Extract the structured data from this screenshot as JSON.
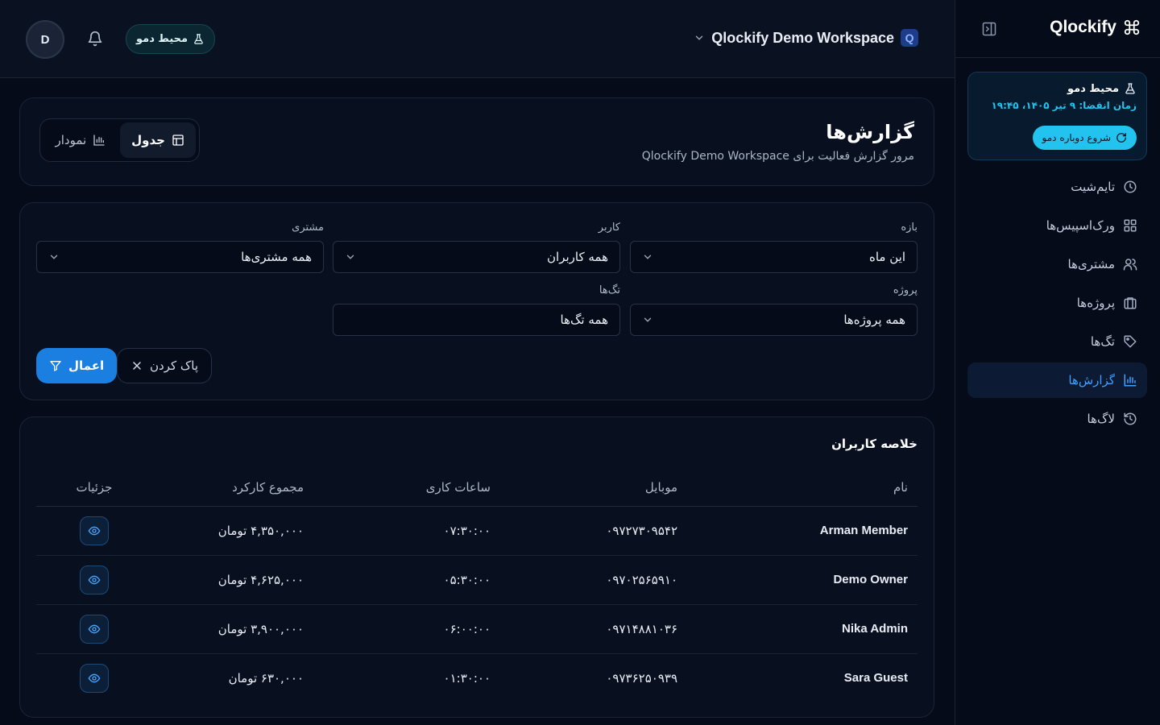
{
  "sidebar": {
    "brand": "Qlockify",
    "demo": {
      "title": "محیط دمو",
      "expires": "زمان انقضا: ۹ تیر ۱۴۰۵، ۱۹:۴۵",
      "restart_label": "شروع دوباره دمو"
    },
    "items": [
      {
        "label": "تایم‌شیت",
        "icon": "clock-icon"
      },
      {
        "label": "ورک‌اسپیس‌ها",
        "icon": "grid-icon"
      },
      {
        "label": "مشتری‌ها",
        "icon": "users-icon"
      },
      {
        "label": "پروژه‌ها",
        "icon": "briefcase-icon"
      },
      {
        "label": "تگ‌ها",
        "icon": "tag-icon"
      },
      {
        "label": "گزارش‌ها",
        "icon": "bar-chart-icon",
        "active": true
      },
      {
        "label": "لاگ‌ها",
        "icon": "history-icon"
      }
    ]
  },
  "topbar": {
    "workspace_name": "Qlockify Demo Workspace",
    "workspace_badge": "Q",
    "env_label": "محیط دمو",
    "avatar_initial": "D"
  },
  "header": {
    "title": "گزارش‌ها",
    "subtitle": "مرور گزارش فعالیت برای Qlockify Demo Workspace",
    "view_table": "جدول",
    "view_chart": "نمودار"
  },
  "filters": {
    "range": {
      "label": "بازه",
      "value": "این ماه"
    },
    "user": {
      "label": "کاربر",
      "value": "همه کاربران"
    },
    "client": {
      "label": "مشتری",
      "value": "همه مشتری‌ها"
    },
    "project": {
      "label": "پروژه",
      "value": "همه پروژه‌ها"
    },
    "tags": {
      "label": "تگ‌ها",
      "value": "همه تگ‌ها"
    },
    "apply_label": "اعمال",
    "clear_label": "پاک کردن"
  },
  "summary": {
    "title": "خلاصه کاربران",
    "columns": {
      "name": "نام",
      "mobile": "موبایل",
      "hours": "ساعات کاری",
      "total": "مجموع کارکرد",
      "details": "جزئیات"
    },
    "rows": [
      {
        "name": "Arman Member",
        "mobile": "۰۹۷۲۷۳۰۹۵۴۲",
        "hours": "۰۷:۳۰:۰۰",
        "total": "۴,۳۵۰,۰۰۰ تومان"
      },
      {
        "name": "Demo Owner",
        "mobile": "۰۹۷۰۲۵۶۵۹۱۰",
        "hours": "۰۵:۳۰:۰۰",
        "total": "۴,۶۲۵,۰۰۰ تومان"
      },
      {
        "name": "Nika Admin",
        "mobile": "۰۹۷۱۴۸۸۱۰۳۶",
        "hours": "۰۶:۰۰:۰۰",
        "total": "۳,۹۰۰,۰۰۰ تومان"
      },
      {
        "name": "Sara Guest",
        "mobile": "۰۹۷۳۶۲۵۰۹۳۹",
        "hours": "۰۱:۳۰:۰۰",
        "total": "۶۳۰,۰۰۰ تومان"
      }
    ]
  },
  "colors": {
    "accent": "#1a7fe0",
    "cyan": "#22c3ee",
    "background": "#050b18"
  }
}
